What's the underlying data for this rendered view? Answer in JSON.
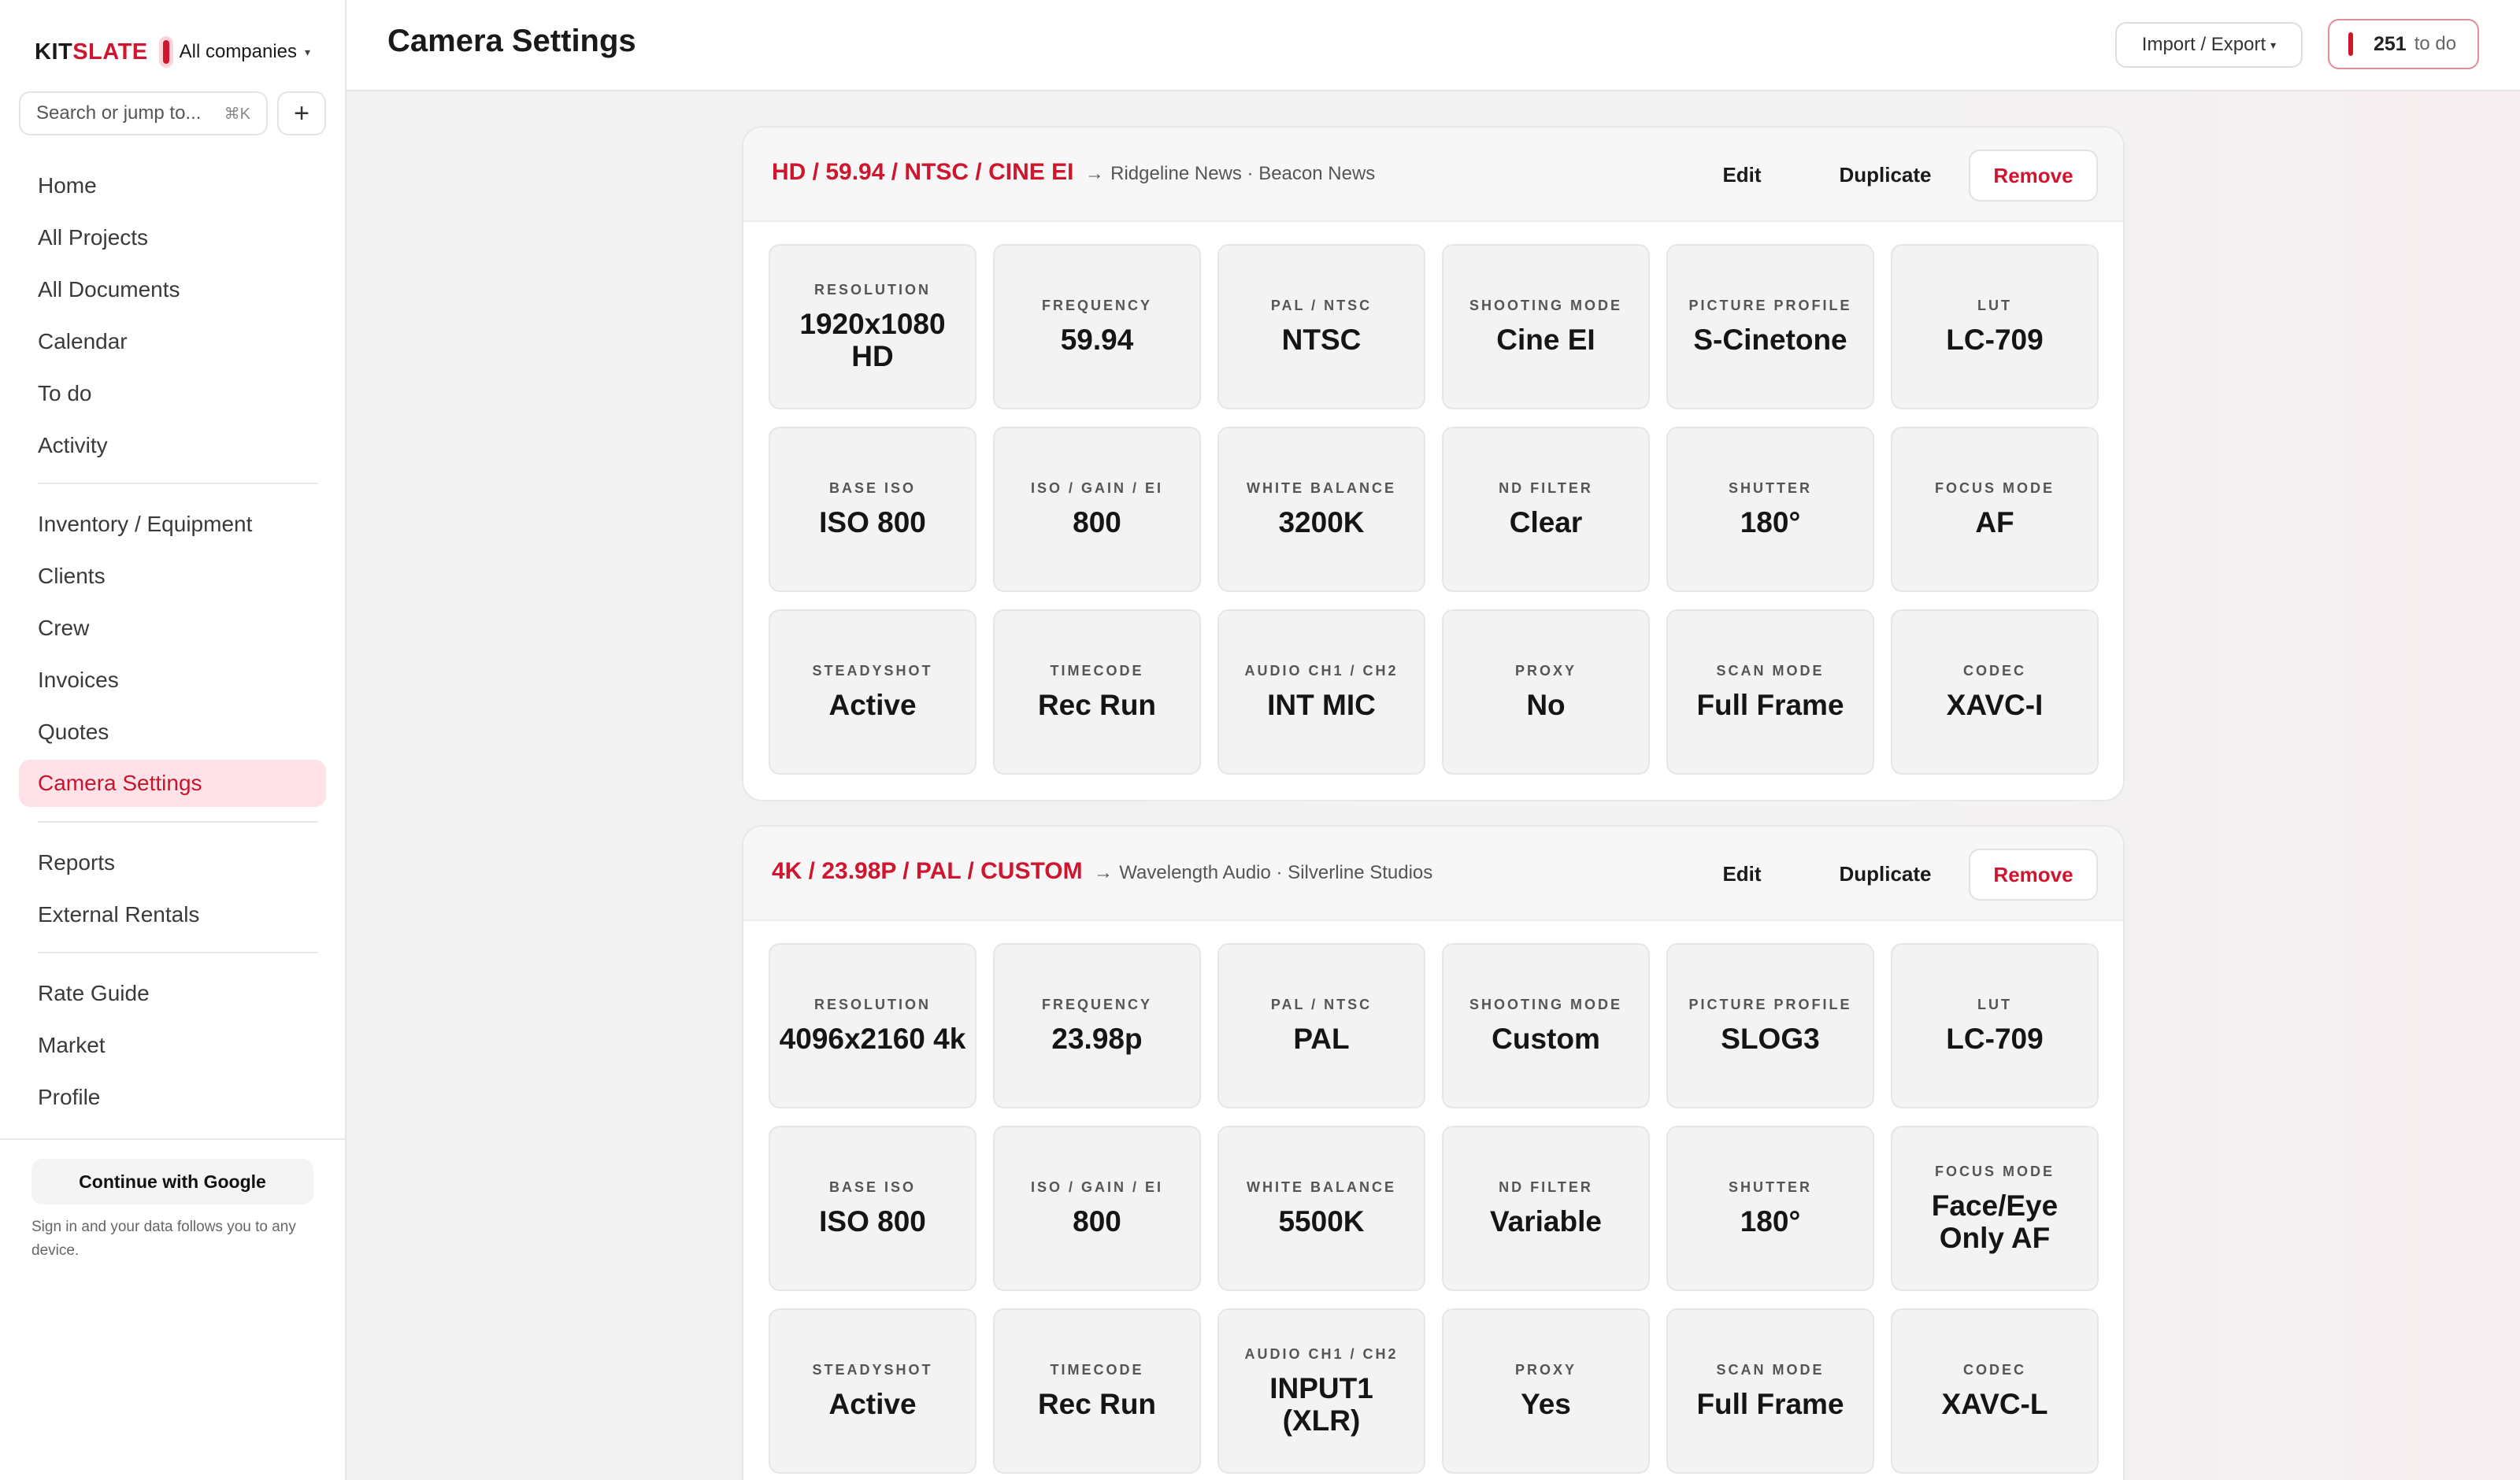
{
  "brand": {
    "part1": "KIT",
    "part2": "SLATE",
    "company": "All companies"
  },
  "search": {
    "placeholder": "Search or jump to...",
    "shortcut": "⌘K",
    "add": "+"
  },
  "nav": {
    "group1": [
      "Home",
      "All Projects",
      "All Documents",
      "Calendar",
      "To do",
      "Activity"
    ],
    "group2": [
      "Inventory / Equipment",
      "Clients",
      "Crew",
      "Invoices",
      "Quotes",
      "Camera Settings"
    ],
    "group3": [
      "Reports",
      "External Rentals"
    ],
    "group4": [
      "Rate Guide",
      "Market",
      "Profile"
    ],
    "active": "Camera Settings"
  },
  "footer": {
    "google_button": "Continue with Google",
    "note": "Sign in and your data follows you to any device."
  },
  "header": {
    "title": "Camera Settings",
    "import_export": "Import / Export",
    "todo_count": "251",
    "todo_label": "to do"
  },
  "colors": {
    "accent": "#d0162e",
    "active_bg": "#fde3e8"
  },
  "icons": {
    "add": "plus-icon",
    "caret": "chevron-down-icon",
    "arrow": "arrow-right-icon"
  },
  "cards": [
    {
      "title": "HD / 59.94 / NTSC / CINE EI",
      "arrow": "→",
      "clients": "Ridgeline News · Beacon News",
      "edit": "Edit",
      "duplicate": "Duplicate",
      "remove": "Remove",
      "cells": [
        {
          "label": "RESOLUTION",
          "value": "1920x1080 HD"
        },
        {
          "label": "FREQUENCY",
          "value": "59.94"
        },
        {
          "label": "PAL / NTSC",
          "value": "NTSC"
        },
        {
          "label": "SHOOTING MODE",
          "value": "Cine EI"
        },
        {
          "label": "PICTURE PROFILE",
          "value": "S-Cinetone"
        },
        {
          "label": "LUT",
          "value": "LC-709"
        },
        {
          "label": "BASE ISO",
          "value": "ISO 800"
        },
        {
          "label": "ISO / GAIN / EI",
          "value": "800"
        },
        {
          "label": "WHITE BALANCE",
          "value": "3200K"
        },
        {
          "label": "ND FILTER",
          "value": "Clear"
        },
        {
          "label": "SHUTTER",
          "value": "180°"
        },
        {
          "label": "FOCUS MODE",
          "value": "AF"
        },
        {
          "label": "STEADYSHOT",
          "value": "Active"
        },
        {
          "label": "TIMECODE",
          "value": "Rec Run"
        },
        {
          "label": "AUDIO CH1 / CH2",
          "value": "INT MIC"
        },
        {
          "label": "PROXY",
          "value": "No"
        },
        {
          "label": "SCAN MODE",
          "value": "Full Frame"
        },
        {
          "label": "CODEC",
          "value": "XAVC-I"
        }
      ]
    },
    {
      "title": "4K / 23.98P / PAL / CUSTOM",
      "arrow": "→",
      "clients": "Wavelength Audio · Silverline Studios",
      "edit": "Edit",
      "duplicate": "Duplicate",
      "remove": "Remove",
      "cells": [
        {
          "label": "RESOLUTION",
          "value": "4096x2160 4k"
        },
        {
          "label": "FREQUENCY",
          "value": "23.98p"
        },
        {
          "label": "PAL / NTSC",
          "value": "PAL"
        },
        {
          "label": "SHOOTING MODE",
          "value": "Custom"
        },
        {
          "label": "PICTURE PROFILE",
          "value": "SLOG3"
        },
        {
          "label": "LUT",
          "value": "LC-709"
        },
        {
          "label": "BASE ISO",
          "value": "ISO 800"
        },
        {
          "label": "ISO / GAIN / EI",
          "value": "800"
        },
        {
          "label": "WHITE BALANCE",
          "value": "5500K"
        },
        {
          "label": "ND FILTER",
          "value": "Variable"
        },
        {
          "label": "SHUTTER",
          "value": "180°"
        },
        {
          "label": "FOCUS MODE",
          "value": "Face/Eye Only AF"
        },
        {
          "label": "STEADYSHOT",
          "value": "Active"
        },
        {
          "label": "TIMECODE",
          "value": "Rec Run"
        },
        {
          "label": "AUDIO CH1 / CH2",
          "value": "INPUT1 (XLR)"
        },
        {
          "label": "PROXY",
          "value": "Yes"
        },
        {
          "label": "SCAN MODE",
          "value": "Full Frame"
        },
        {
          "label": "CODEC",
          "value": "XAVC-L"
        }
      ]
    }
  ]
}
